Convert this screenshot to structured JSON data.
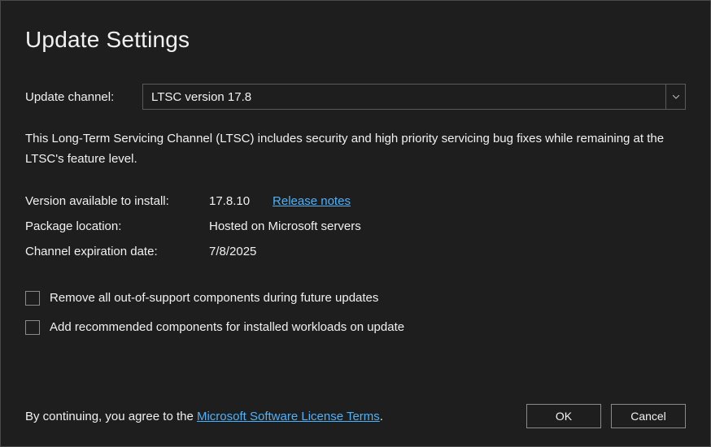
{
  "title": "Update Settings",
  "channel": {
    "label": "Update channel:",
    "selected": "LTSC version 17.8"
  },
  "description": "This Long-Term Servicing Channel (LTSC) includes security and high priority servicing bug fixes while remaining at the LTSC's feature level.",
  "info": {
    "version_label": "Version available to install:",
    "version_value": "17.8.10",
    "release_notes_link": "Release notes",
    "package_label": "Package location:",
    "package_value": "Hosted on Microsoft servers",
    "expiration_label": "Channel expiration date:",
    "expiration_value": "7/8/2025"
  },
  "checkboxes": {
    "remove_oos": "Remove all out-of-support components during future updates",
    "add_recommended": "Add recommended components for installed workloads on update"
  },
  "footer": {
    "agree_prefix": "By continuing, you agree to the ",
    "license_link": "Microsoft Software License Terms",
    "agree_suffix": ".",
    "ok_label": "OK",
    "cancel_label": "Cancel"
  }
}
